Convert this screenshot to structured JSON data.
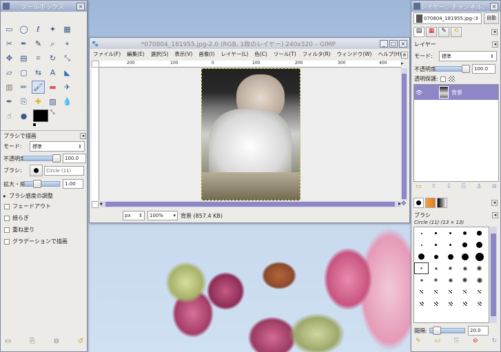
{
  "toolbox": {
    "title": "ツールボックス",
    "tool_icons": [
      "rect-select",
      "ellipse-select",
      "free-select",
      "fuzzy-select",
      "color-select",
      "scissors-select",
      "paths",
      "color-picker",
      "zoom",
      "measure",
      "move",
      "align",
      "crop",
      "rotate",
      "scale",
      "shear",
      "perspective",
      "flip",
      "text",
      "bucket-fill",
      "blend",
      "pencil",
      "paintbrush",
      "eraser",
      "airbrush",
      "ink",
      "clone",
      "heal",
      "perspective-clone",
      "blur",
      "smudge",
      "dodge-burn"
    ],
    "options_title": "ブラシで描画",
    "mode_label": "モード:",
    "mode_value": "標準",
    "opacity_label": "不透明度:",
    "opacity_value": "100.0",
    "brush_label": "ブラシ:",
    "brush_value": "Circle (11)",
    "scale_label": "拡大・縮小:",
    "scale_value": "1.00",
    "pressure_label": "ブラシ感度の調整",
    "fade_label": "フェードアウト",
    "jitter_label": "揺らぎ",
    "incremental_label": "重ね塗り",
    "gradient_label": "グラデーションで描画"
  },
  "image_window": {
    "title": "*070804_181955.jpg-2.0 (RGB, 1枚のレイヤー) 240x320 – GIMP",
    "menu": [
      "ファイル(F)",
      "編集(E)",
      "選択(S)",
      "表示(V)",
      "画像(I)",
      "レイヤー(L)",
      "色(C)",
      "ツール(T)",
      "フィルタ(R)",
      "ウィンドウ(W)",
      "ヘルプ(H)"
    ],
    "ruler_marks": [
      "200",
      "100",
      "0",
      "100",
      "200",
      "300",
      "400"
    ],
    "unit": "px",
    "zoom": "100%",
    "status": "背景 (857.4 KB)"
  },
  "layers": {
    "title": "レイヤー、チャンネル、...",
    "image_name": "070804_181955.jpg-2",
    "auto_label": "自動",
    "panel_title": "レイヤー",
    "mode_label": "モード:",
    "mode_value": "標準",
    "opacity_label": "不透明度:",
    "opacity_value": "100.0",
    "lock_label": "透明保護:",
    "layer_name": "背景"
  },
  "brushes": {
    "panel_title": "ブラシ",
    "selected_name": "Circle (11) (13 × 13)",
    "spacing_label": "間隔:",
    "spacing_value": "20.0"
  },
  "colors": {
    "accent": "#8d86c7",
    "title_bar": "#9eacca",
    "foreground": "#000000",
    "background": "#ffffff"
  }
}
